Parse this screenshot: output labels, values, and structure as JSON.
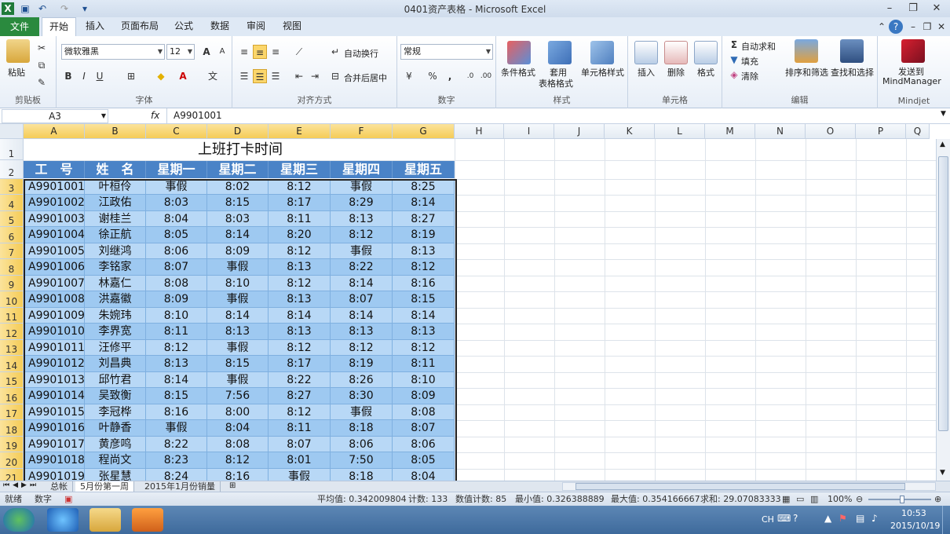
{
  "window": {
    "title": "0401资产表格 - Microsoft Excel"
  },
  "tabs": [
    "文件",
    "开始",
    "插入",
    "页面布局",
    "公式",
    "数据",
    "审阅",
    "视图"
  ],
  "ribbon": {
    "clipboard": {
      "label": "剪贴板",
      "paste": "粘贴"
    },
    "font": {
      "label": "字体",
      "name": "微软雅黑",
      "size": "12",
      "bold": "B",
      "italic": "I",
      "underline": "U"
    },
    "align": {
      "label": "对齐方式",
      "wrap": "自动换行",
      "merge": "合并后居中"
    },
    "number": {
      "label": "数字",
      "format": "常规",
      "percent": "%",
      "comma": ","
    },
    "styles": {
      "label": "样式",
      "cond": "条件格式",
      "table_line1": "套用",
      "table_line2": "表格格式",
      "cell": "单元格样式"
    },
    "cells": {
      "label": "单元格",
      "insert": "插入",
      "delete": "删除",
      "format": "格式"
    },
    "edit": {
      "label": "编辑",
      "autosum": "自动求和",
      "fill": "填充",
      "clear": "清除",
      "sort": "排序和筛选",
      "find": "查找和选择"
    },
    "mindjet": {
      "label": "Mindjet",
      "send1": "发送到",
      "send2": "MindManager"
    }
  },
  "formula": {
    "namebox": "A3",
    "fx": "fx",
    "value": "A9901001"
  },
  "columns": [
    "A",
    "B",
    "C",
    "D",
    "E",
    "F",
    "G",
    "H",
    "I",
    "J",
    "K",
    "L",
    "M",
    "N",
    "O",
    "P",
    "Q"
  ],
  "rows": [
    "1",
    "2",
    "3",
    "4",
    "5",
    "6",
    "7",
    "8",
    "9",
    "10",
    "11",
    "12",
    "13",
    "14",
    "15",
    "16",
    "17",
    "18",
    "19",
    "20",
    "21"
  ],
  "sheet": {
    "title": "上班打卡时间",
    "headers": [
      "工　号",
      "姓　名",
      "星期一",
      "星期二",
      "星期三",
      "星期四",
      "星期五"
    ],
    "data": [
      [
        "A9901001",
        "叶桓伶",
        "事假",
        "8:02",
        "8:12",
        "事假",
        "8:25"
      ],
      [
        "A9901002",
        "江政佑",
        "8:03",
        "8:15",
        "8:17",
        "8:29",
        "8:14"
      ],
      [
        "A9901003",
        "谢桂兰",
        "8:04",
        "8:03",
        "8:11",
        "8:13",
        "8:27"
      ],
      [
        "A9901004",
        "徐正航",
        "8:05",
        "8:14",
        "8:20",
        "8:12",
        "8:19"
      ],
      [
        "A9901005",
        "刘继鸿",
        "8:06",
        "8:09",
        "8:12",
        "事假",
        "8:13"
      ],
      [
        "A9901006",
        "李铭家",
        "8:07",
        "事假",
        "8:13",
        "8:22",
        "8:12"
      ],
      [
        "A9901007",
        "林嘉仁",
        "8:08",
        "8:10",
        "8:12",
        "8:14",
        "8:16"
      ],
      [
        "A9901008",
        "洪嘉徽",
        "8:09",
        "事假",
        "8:13",
        "8:07",
        "8:15"
      ],
      [
        "A9901009",
        "朱婉玮",
        "8:10",
        "8:14",
        "8:14",
        "8:14",
        "8:14"
      ],
      [
        "A9901010",
        "李界宽",
        "8:11",
        "8:13",
        "8:13",
        "8:13",
        "8:13"
      ],
      [
        "A9901011",
        "汪修平",
        "8:12",
        "事假",
        "8:12",
        "8:12",
        "8:12"
      ],
      [
        "A9901012",
        "刘昌典",
        "8:13",
        "8:15",
        "8:17",
        "8:19",
        "8:11"
      ],
      [
        "A9901013",
        "邱竹君",
        "8:14",
        "事假",
        "8:22",
        "8:26",
        "8:10"
      ],
      [
        "A9901014",
        "吴致衡",
        "8:15",
        "7:56",
        "8:27",
        "8:30",
        "8:09"
      ],
      [
        "A9901015",
        "李冠桦",
        "8:16",
        "8:00",
        "8:12",
        "事假",
        "8:08"
      ],
      [
        "A9901016",
        "叶静香",
        "事假",
        "8:04",
        "8:11",
        "8:18",
        "8:07"
      ],
      [
        "A9901017",
        "黄彦鸣",
        "8:22",
        "8:08",
        "8:07",
        "8:06",
        "8:06"
      ],
      [
        "A9901018",
        "程尚文",
        "8:23",
        "8:12",
        "8:01",
        "7:50",
        "8:05"
      ],
      [
        "A9901019",
        "张星慧",
        "8:24",
        "8:16",
        "事假",
        "8:18",
        "8:04"
      ]
    ]
  },
  "sheet_tabs": [
    "总帐",
    "5月份第一周",
    "2015年1月份销量"
  ],
  "status": {
    "ready": "就绪",
    "mode": "数字",
    "avg": "平均值: 0.342009804",
    "count": "计数: 133",
    "numcount": "数值计数: 85",
    "min": "最小值: 0.326388889",
    "max": "最大值: 0.354166667",
    "sum": "求和: 29.07083333",
    "zoom": "100%"
  },
  "taskbar": {
    "lang": "CH",
    "time": "10:53",
    "date": "2015/10/19"
  }
}
